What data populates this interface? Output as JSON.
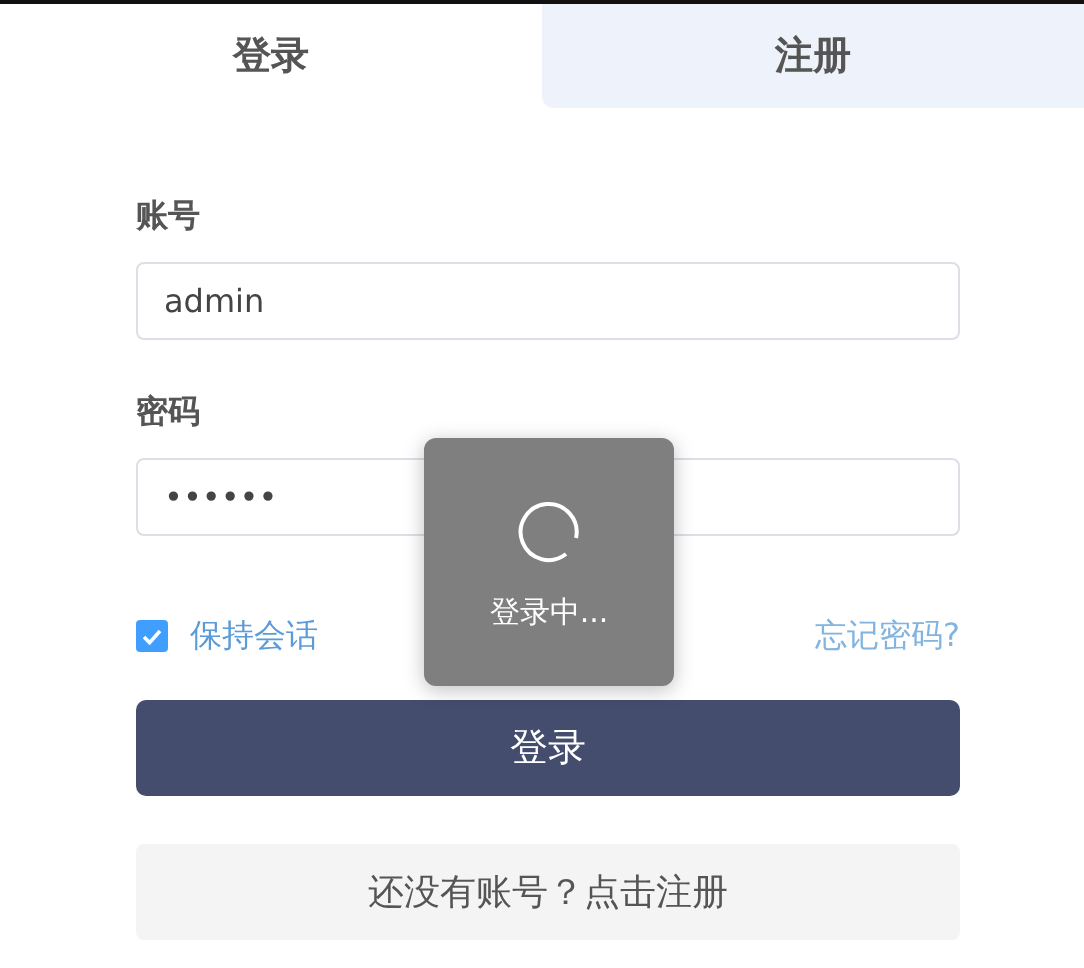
{
  "tabs": [
    {
      "label": "登录",
      "selected": true
    },
    {
      "label": "注册",
      "selected": false
    }
  ],
  "form": {
    "fields": [
      {
        "label": "账号",
        "value": "admin"
      },
      {
        "label": "密码",
        "value": "••••••"
      }
    ],
    "remember": {
      "label": "保持会话",
      "checked": true
    },
    "forgot_link": "忘记密码?",
    "submit_button": "登录",
    "register_button": "还没有账号？点击注册"
  },
  "loading_toast": {
    "text": "登录中..."
  }
}
